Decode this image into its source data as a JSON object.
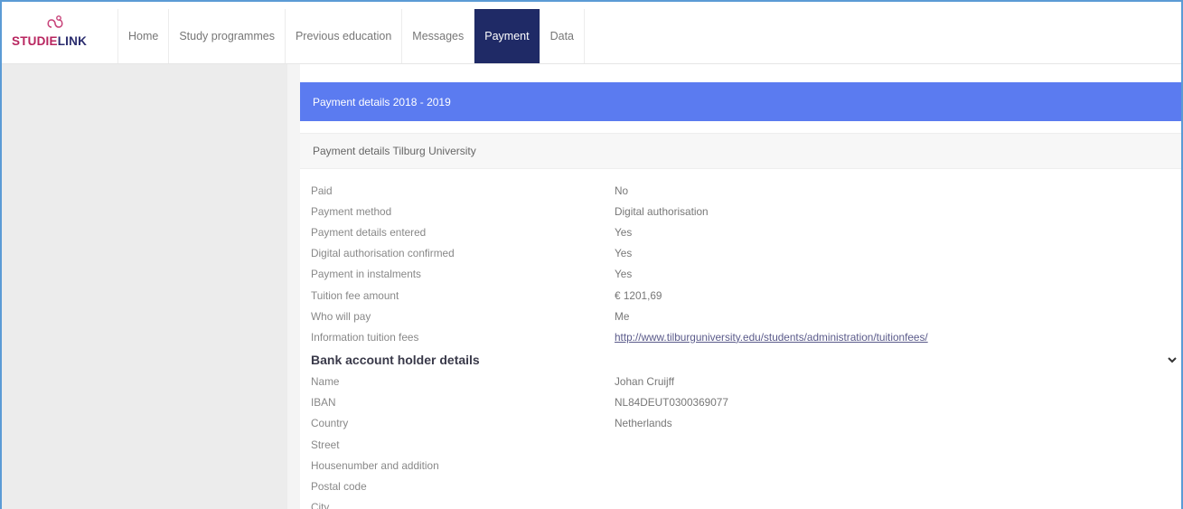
{
  "brand": {
    "logo_prefix": "STUDIE",
    "logo_suffix": "LINK",
    "accent_color": "#b8255f",
    "navy_color": "#1f2a66"
  },
  "nav": {
    "items": [
      {
        "label": "Home",
        "active": false
      },
      {
        "label": "Study programmes",
        "active": false
      },
      {
        "label": "Previous education",
        "active": false
      },
      {
        "label": "Messages",
        "active": false
      },
      {
        "label": "Payment",
        "active": true
      },
      {
        "label": "Data",
        "active": false
      }
    ]
  },
  "panel": {
    "header": "Payment details 2018 - 2019",
    "subheader": "Payment details Tilburg University"
  },
  "payment_rows": [
    {
      "label": "Paid",
      "value": "No"
    },
    {
      "label": "Payment method",
      "value": "Digital authorisation"
    },
    {
      "label": "Payment details entered",
      "value": "Yes"
    },
    {
      "label": "Digital authorisation confirmed",
      "value": "Yes"
    },
    {
      "label": "Payment in instalments",
      "value": "Yes"
    },
    {
      "label": "Tuition fee amount",
      "value": "€ 1201,69"
    },
    {
      "label": "Who will pay",
      "value": "Me"
    },
    {
      "label": "Information tuition fees",
      "value": "http://www.tilburguniversity.edu/students/administration/tuitionfees/"
    }
  ],
  "bank": {
    "title": "Bank account holder details",
    "rows": [
      {
        "label": "Name",
        "value": "Johan Cruijff"
      },
      {
        "label": "IBAN",
        "value": "NL84DEUT0300369077"
      },
      {
        "label": "Country",
        "value": "Netherlands"
      },
      {
        "label": "Street",
        "value": ""
      },
      {
        "label": "Housenumber and addition",
        "value": ""
      },
      {
        "label": "Postal code",
        "value": ""
      },
      {
        "label": "City",
        "value": ""
      }
    ]
  }
}
